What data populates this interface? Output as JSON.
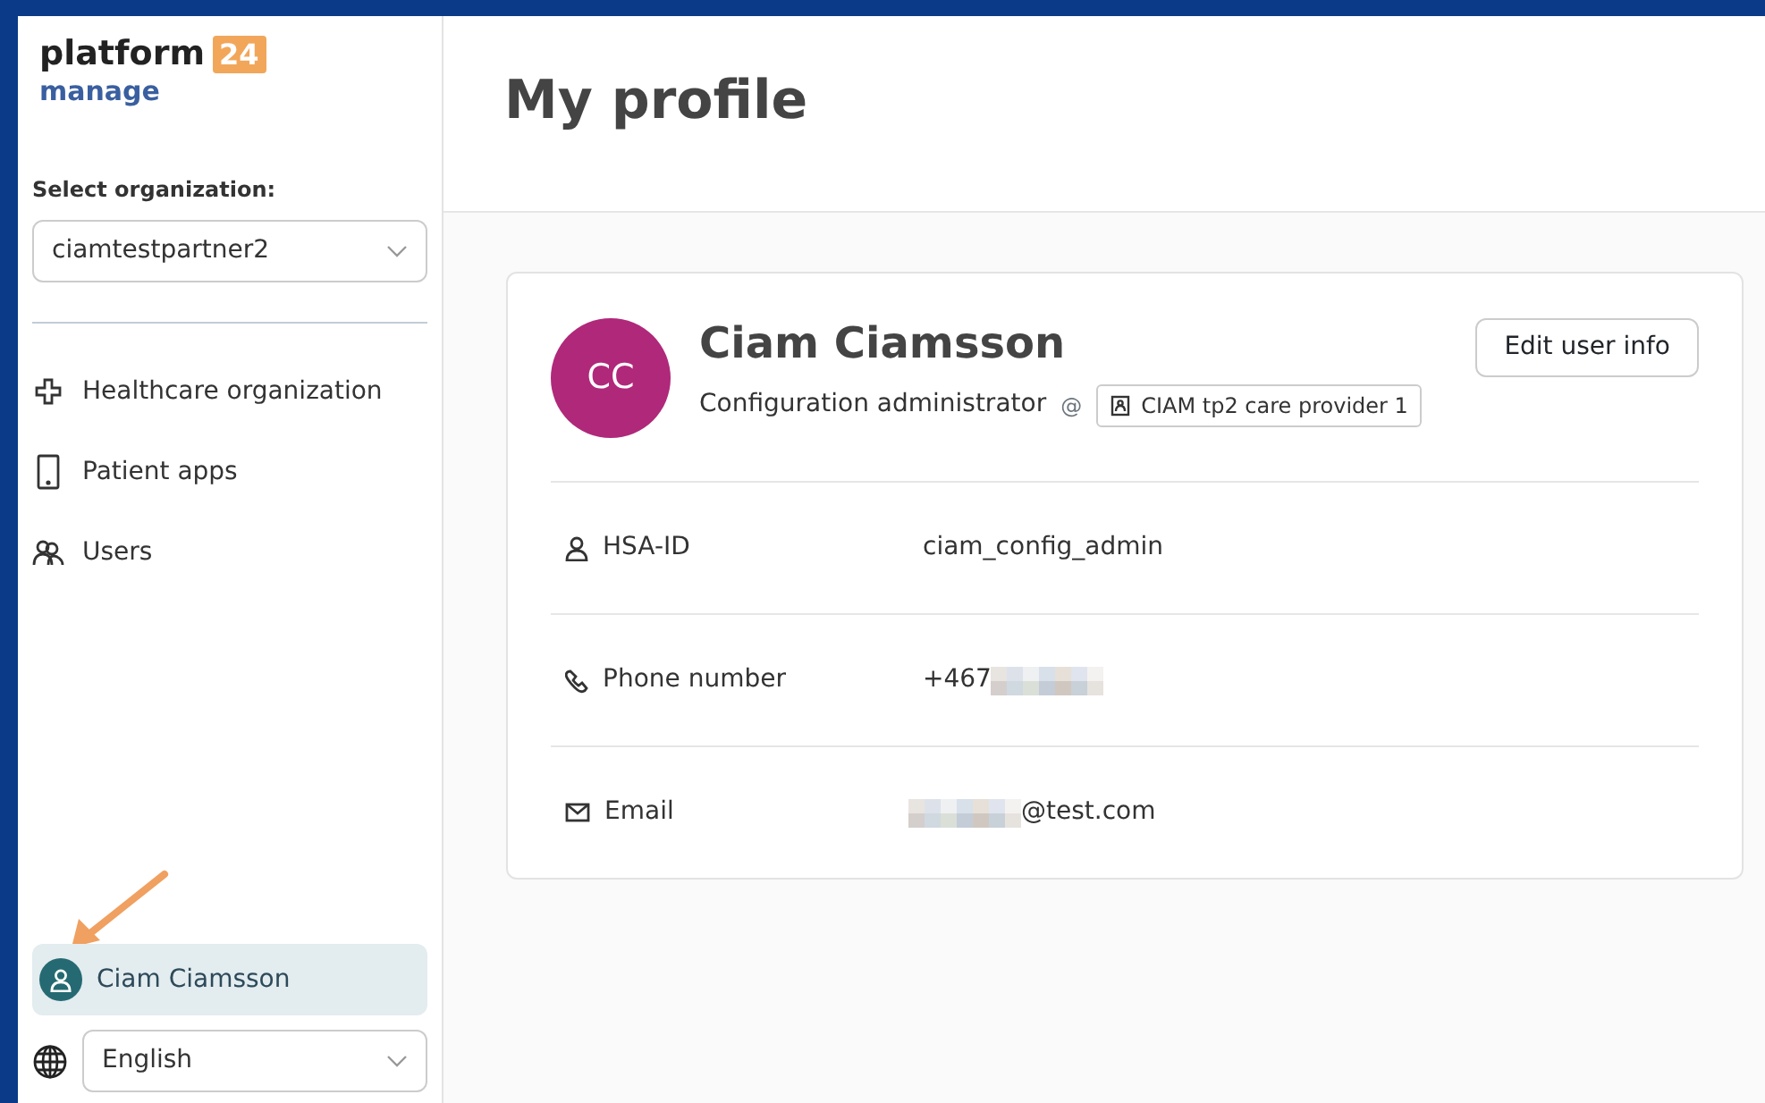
{
  "sidebar": {
    "logo": {
      "text": "platform",
      "badge": "24",
      "subtitle": "manage"
    },
    "organization_select": {
      "label": "Select organization:",
      "value": "ciamtestpartner2"
    },
    "nav_items": [
      {
        "kind": "cross",
        "label": "Healthcare organization"
      },
      {
        "kind": "phone",
        "label": "Patient apps"
      },
      {
        "kind": "users",
        "label": "Users"
      }
    ],
    "user_menu": {
      "name": "Ciam Ciamsson",
      "selected": true
    },
    "language_select": {
      "value": "English"
    }
  },
  "page_title": "My profile",
  "profile": {
    "initials": "CC",
    "name": "Ciam Ciamsson",
    "role": "Configuration administrator",
    "separator": "@",
    "unit": "CIAM tp2 care provider 1",
    "edit_button": "Edit user info",
    "fields": [
      {
        "kind": "person",
        "label": "HSA-ID",
        "value": "ciam_config_admin",
        "masked_before": false,
        "masked_after": false
      },
      {
        "kind": "phone",
        "label": "Phone number",
        "value": "+467",
        "masked_before": false,
        "masked_after": true
      },
      {
        "kind": "mail",
        "label": "Email",
        "value": "@test.com",
        "masked_before": true,
        "masked_after": false
      }
    ]
  }
}
